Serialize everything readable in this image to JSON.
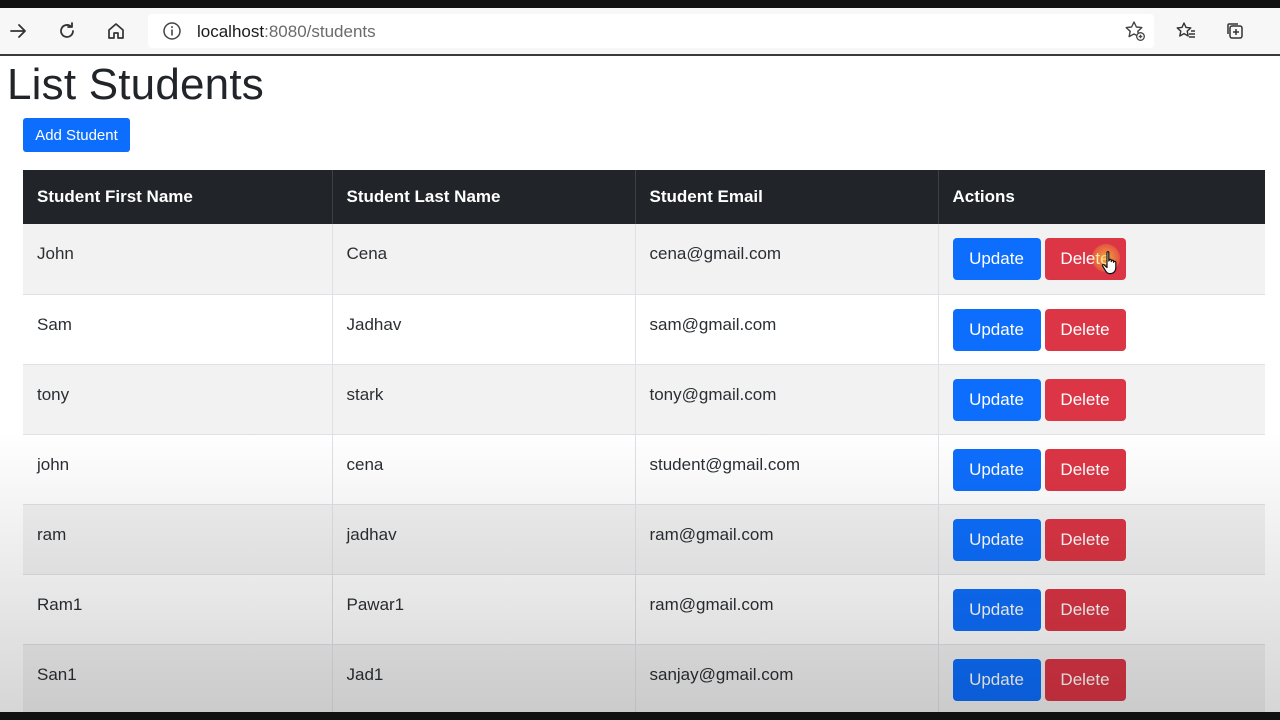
{
  "browser": {
    "url_host": "localhost",
    "url_rest": ":8080/students"
  },
  "page": {
    "title": "List Students",
    "add_button_label": "Add Student"
  },
  "table": {
    "headers": [
      "Student First Name",
      "Student Last Name",
      "Student Email",
      "Actions"
    ],
    "update_label": "Update",
    "delete_label": "Delete",
    "rows": [
      {
        "first": "John",
        "last": "Cena",
        "email": "cena@gmail.com"
      },
      {
        "first": "Sam",
        "last": "Jadhav",
        "email": "sam@gmail.com"
      },
      {
        "first": "tony",
        "last": "stark",
        "email": "tony@gmail.com"
      },
      {
        "first": "john",
        "last": "cena",
        "email": "student@gmail.com"
      },
      {
        "first": "ram",
        "last": "jadhav",
        "email": "ram@gmail.com"
      },
      {
        "first": "Ram1",
        "last": "Pawar1",
        "email": "ram@gmail.com"
      },
      {
        "first": "San1",
        "last": "Jad1",
        "email": "sanjay@gmail.com"
      }
    ]
  },
  "colors": {
    "primary": "#0d6efd",
    "danger": "#dc3545",
    "header_dark": "#212529"
  }
}
